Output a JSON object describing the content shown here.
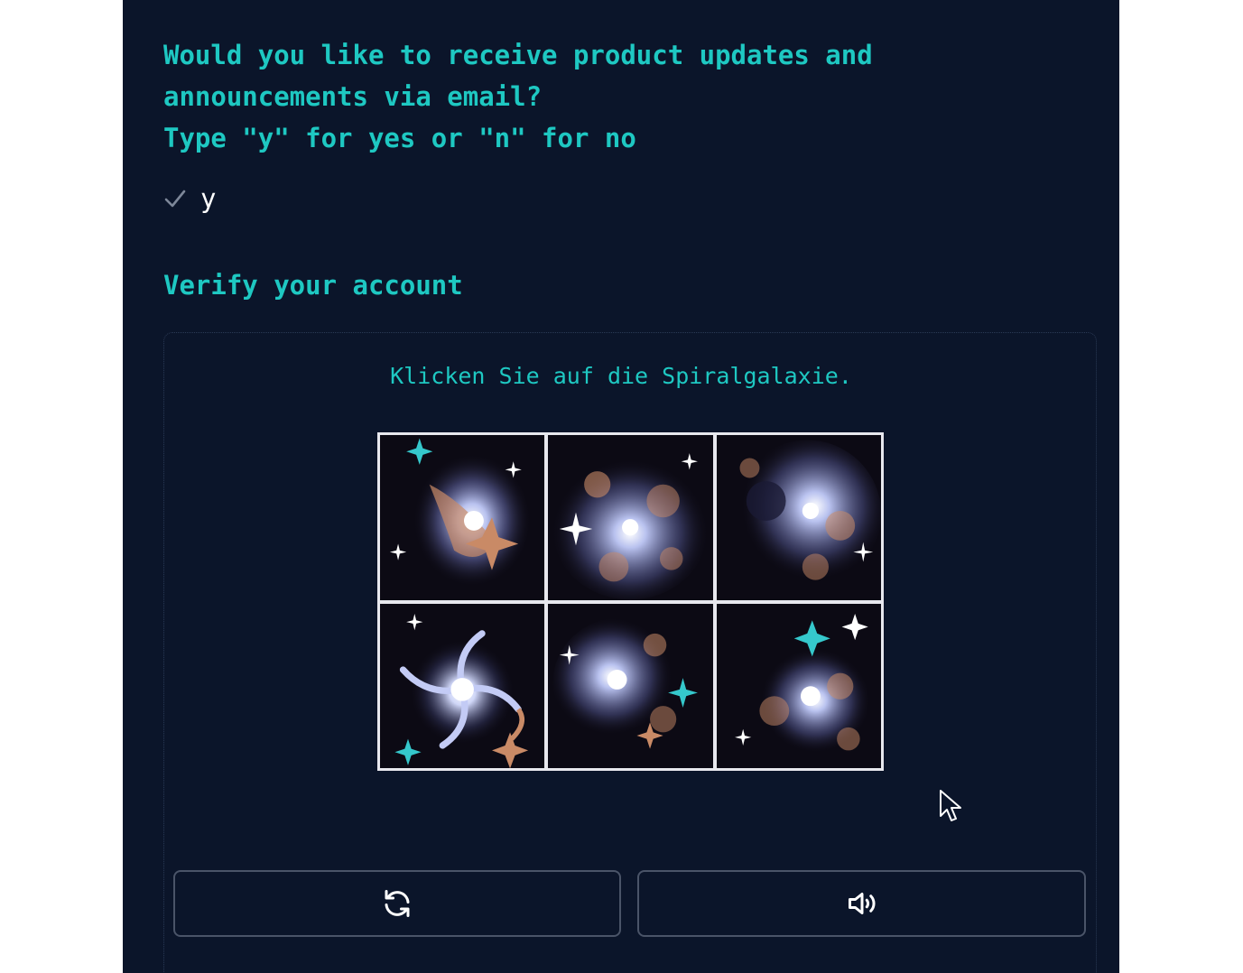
{
  "question": {
    "line1": "Would you like to receive product updates and",
    "line2": "announcements via email?",
    "line3": "Type \"y\" for yes or \"n\" for no"
  },
  "answer": {
    "icon": "checkmark-icon",
    "value": "y"
  },
  "verify": {
    "heading": "Verify your account"
  },
  "captcha": {
    "instruction": "Klicken Sie auf die Spiralgalaxie.",
    "tiles": [
      {
        "content": "irregular galaxy"
      },
      {
        "content": "irregular galaxy"
      },
      {
        "content": "irregular galaxy"
      },
      {
        "content": "spiral galaxy"
      },
      {
        "content": "irregular galaxy"
      },
      {
        "content": "irregular galaxy"
      }
    ],
    "refresh_icon": "refresh-icon",
    "audio_icon": "speaker-icon"
  },
  "colors": {
    "background": "#0b152a",
    "accent": "#1ec8c2",
    "text": "#ffffff",
    "button_border": "#4a5468"
  }
}
